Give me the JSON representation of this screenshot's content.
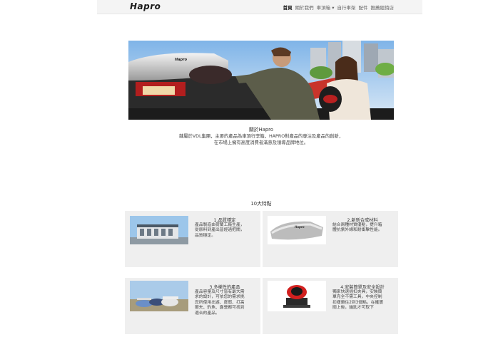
{
  "header": {
    "logo": "Hapro",
    "nav": [
      "首頁",
      "關於我們",
      "車頂箱 ▾",
      "自行車架",
      "配件",
      "推薦經銷店"
    ]
  },
  "hero": {
    "box_brand": "Hapro"
  },
  "about": {
    "title": "關於Hapro",
    "lines": [
      "隸屬於VDL集團，主要的產品為車頂行李箱，HAPRO對產品的專注及產品的創新，",
      "在市場上擁有高度消費者滿意及領導品牌地位。"
    ]
  },
  "features": {
    "title": "10大特點",
    "cards": [
      {
        "title": "1.品質穩定",
        "lines": [
          "產品製造由荷蘭工廠生產，",
          "從原料到產出皆經過把關，",
          "品質穩定。"
        ]
      },
      {
        "title": "2.創新合成材料",
        "lines": [
          "結合兩種材質優點，提升箱",
          "體抗紫外線和耐衝擊性能。"
        ]
      },
      {
        "title": "3.多樣性的產品",
        "lines": [
          "產品容量及尺寸皆有最大需",
          "求的設計，可依您的需求挑",
          "您所使用出遊、度假、打高",
          "爾夫、釣魚、露營都可找到",
          "適合的產品。"
        ]
      },
      {
        "title": "4.安裝簡單及安全設計",
        "lines": [
          "獨家快速插扣夾具，安裝簡",
          "單完全不需工具，中央控制",
          "扣樣鎖住2到3個點，在確實",
          "關上後，鑰匙才可取下"
        ]
      }
    ]
  }
}
